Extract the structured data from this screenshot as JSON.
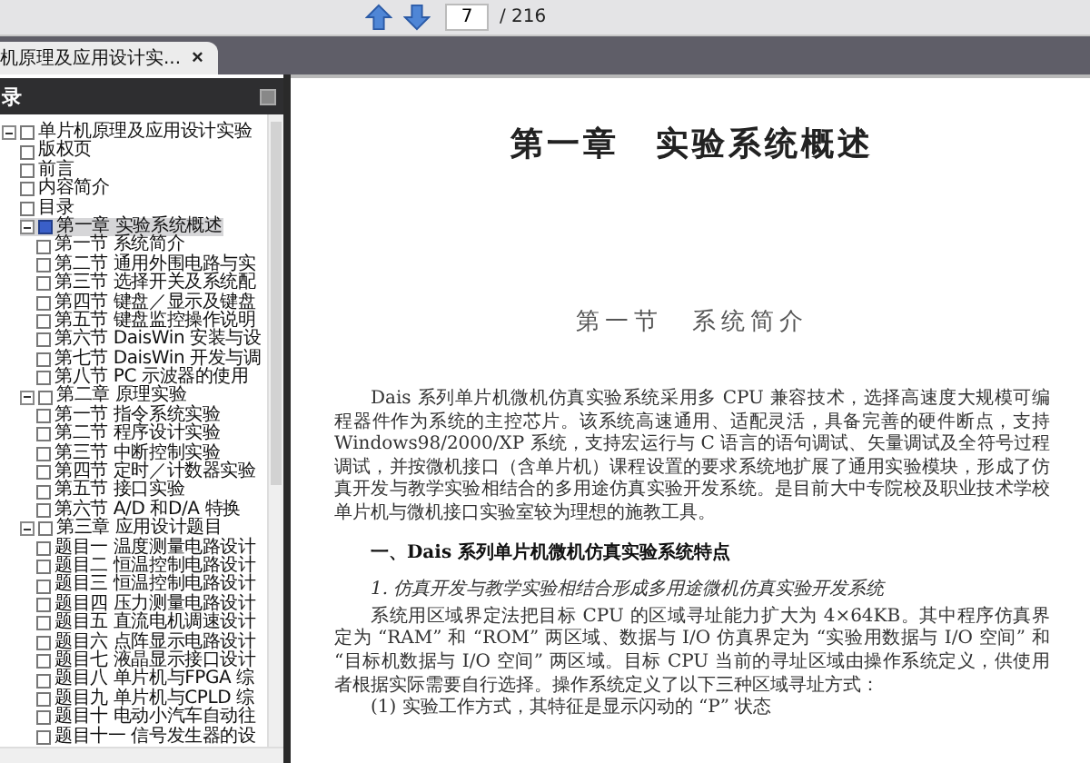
{
  "toolbar": {
    "page_field": {
      "value": "7"
    },
    "page_total": "/ 216"
  },
  "tabs": [
    {
      "label": "机原理及应用设计实...",
      "selected": true,
      "close": "×"
    }
  ],
  "sidebar": {
    "title": "录",
    "items": [
      {
        "label": "单片机原理及应用设计实验",
        "selected": false,
        "expanded": true,
        "children": [
          {
            "label": "版权页",
            "selected": false
          },
          {
            "label": "前言",
            "selected": false
          },
          {
            "label": "内容简介",
            "selected": false
          },
          {
            "label": "目录",
            "selected": false
          },
          {
            "label": "第一章 实验系统概述",
            "selected": true,
            "expanded": true,
            "children": [
              {
                "label": "第一节 系统简介",
                "selected": false
              },
              {
                "label": "第二节 通用外围电路与实",
                "selected": false
              },
              {
                "label": "第三节 选择开关及系统配",
                "selected": false
              },
              {
                "label": "第四节 键盘／显示及键盘",
                "selected": false
              },
              {
                "label": "第五节 键盘监控操作说明",
                "selected": false
              },
              {
                "label": "第六节 DaisWin 安装与设",
                "selected": false
              },
              {
                "label": "第七节 DaisWin 开发与调",
                "selected": false
              },
              {
                "label": "第八节 PC 示波器的使用",
                "selected": false
              }
            ]
          },
          {
            "label": "第二章 原理实验",
            "selected": false,
            "expanded": true,
            "children": [
              {
                "label": "第一节 指令系统实验",
                "selected": false
              },
              {
                "label": "第二节 程序设计实验",
                "selected": false
              },
              {
                "label": "第三节 中断控制实验",
                "selected": false
              },
              {
                "label": "第四节 定时／计数器实验",
                "selected": false
              },
              {
                "label": "第五节 接口实验",
                "selected": false
              },
              {
                "label": "第六节 A/D 和D/A 特换",
                "selected": false
              }
            ]
          },
          {
            "label": "第三章 应用设计题目",
            "selected": false,
            "expanded": true,
            "children": [
              {
                "label": "题目一 温度测量电路设计",
                "selected": false
              },
              {
                "label": "题目二 恒温控制电路设计",
                "selected": false
              },
              {
                "label": "题目三 恒温控制电路设计",
                "selected": false
              },
              {
                "label": "题目四 压力测量电路设计",
                "selected": false
              },
              {
                "label": "题目五 直流电机调速设计",
                "selected": false
              },
              {
                "label": "题目六 点阵显示电路设计",
                "selected": false
              },
              {
                "label": "题目七 液晶显示接口设计",
                "selected": false
              },
              {
                "label": "题目八 单片机与FPGA 综",
                "selected": false
              },
              {
                "label": "题目九 单片机与CPLD 综",
                "selected": false
              },
              {
                "label": "题目十 电动小汽车自动往",
                "selected": false
              },
              {
                "label": "题目十一 信号发生器的设",
                "selected": false
              }
            ]
          }
        ]
      }
    ]
  },
  "document": {
    "chapter_title": "第一章　实验系统概述",
    "section_title": "第一节　系统简介",
    "blocks": [
      {
        "kind": "paragraph",
        "text": "Dais 系列单片机微机仿真实验系统采用多 CPU 兼容技术，选择高速度大规模可编程器件作为系统的主控芯片。该系统高速通用、适配灵活，具备完善的硬件断点，支持 Windows98/2000/XP 系统，支持宏运行与 C 语言的语句调试、矢量调试及全符号过程调试，并按微机接口（含单片机）课程设置的要求系统地扩展了通用实验模块，形成了仿真开发与教学实验相结合的多用途仿真实验开发系统。是目前大中专院校及职业技术学校单片机与微机接口实验室较为理想的施教工具。"
      },
      {
        "kind": "heading",
        "text": "一、Dais 系列单片机微机仿真实验系统特点"
      },
      {
        "kind": "subheading",
        "text": "1. 仿真开发与教学实验相结合形成多用途微机仿真实验开发系统"
      },
      {
        "kind": "paragraph",
        "text": "系统用区域界定法把目标 CPU 的区域寻址能力扩大为 4×64KB。其中程序仿真界定为 “RAM” 和 “ROM” 两区域、数据与 I/O 仿真界定为 “实验用数据与 I/O 空间” 和 “目标机数据与 I/O 空间” 两区域。目标 CPU 当前的寻址区域由操作系统定义，供使用者根据实际需要自行选择。操作系统定义了以下三种区域寻址方式："
      },
      {
        "kind": "list_item",
        "text": "(1) 实验工作方式，其特征是显示闪动的 “P” 状态"
      }
    ]
  }
}
